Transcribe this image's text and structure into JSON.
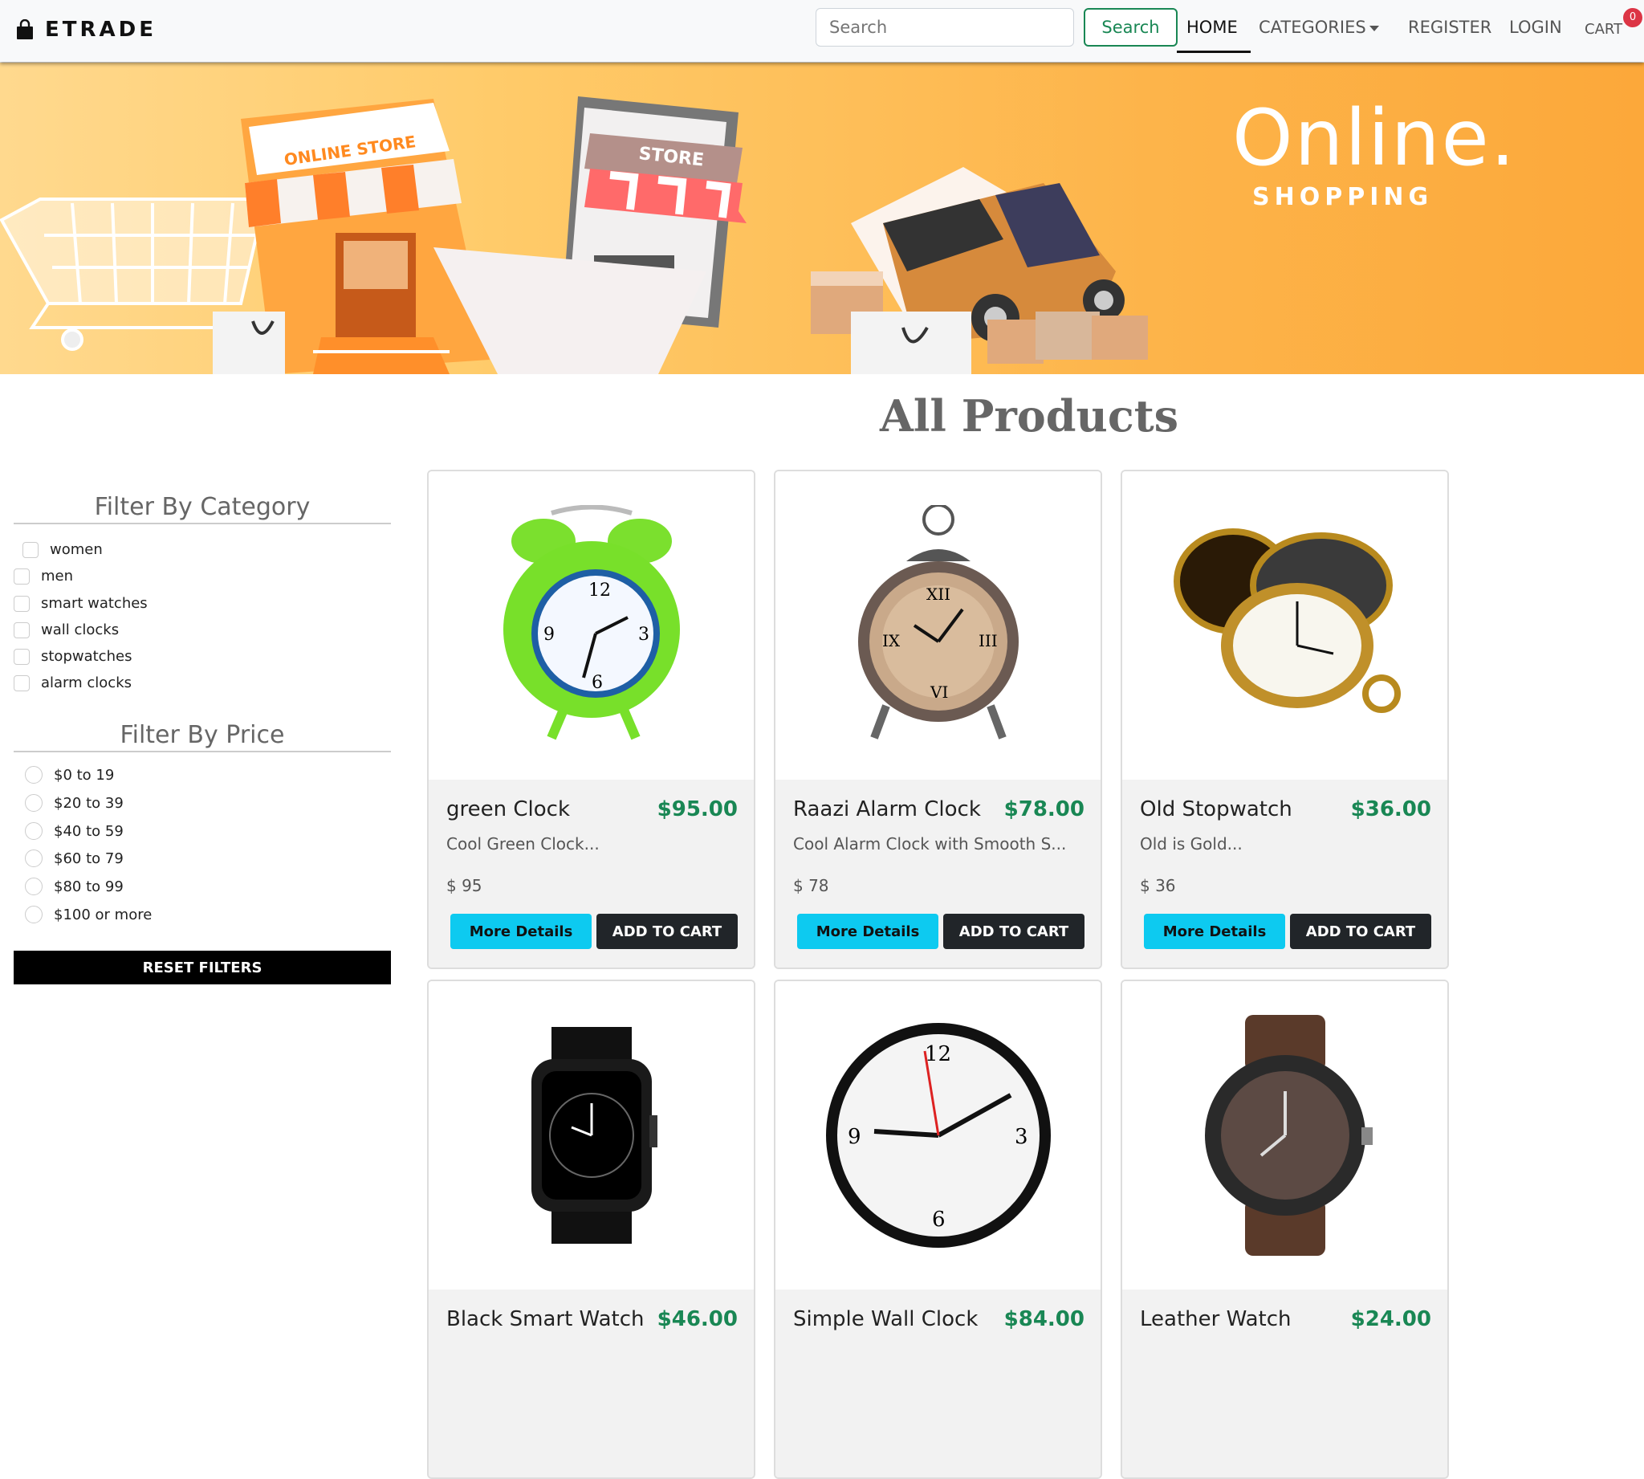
{
  "nav": {
    "brand": "ETRADE",
    "search_placeholder": "Search",
    "search_button": "Search",
    "home": "HOME",
    "categories": "CATEGORIES",
    "register": "REGISTER",
    "login": "LOGIN",
    "cart": "CART",
    "cart_count": "0"
  },
  "banner": {
    "title": "Online.",
    "subtitle": "SHOPPING",
    "store_sign": "ONLINE STORE",
    "phone_sign": "STORE"
  },
  "page_title": "All Products",
  "filters": {
    "category_heading": "Filter By Category",
    "categories": [
      "women",
      "men",
      "smart watches",
      "wall clocks",
      "stopwatches",
      "alarm clocks"
    ],
    "price_heading": "Filter By Price",
    "prices": [
      "$0 to 19",
      "$20 to 39",
      "$40 to 59",
      "$60 to 79",
      "$80 to 99",
      "$100 or more"
    ],
    "reset": "RESET FILTERS"
  },
  "products": [
    {
      "name": "green Clock",
      "price": "$95.00",
      "desc": "Cool Green Clock...",
      "sub": "$ 95",
      "more": "More Details",
      "add": "ADD TO CART"
    },
    {
      "name": "Raazi Alarm Clock",
      "price": "$78.00",
      "desc": "Cool Alarm Clock with Smooth S...",
      "sub": "$ 78",
      "more": "More Details",
      "add": "ADD TO CART"
    },
    {
      "name": "Old Stopwatch",
      "price": "$36.00",
      "desc": "Old is Gold...",
      "sub": "$ 36",
      "more": "More Details",
      "add": "ADD TO CART"
    },
    {
      "name": "Black Smart Watch",
      "price": "$46.00"
    },
    {
      "name": "Simple Wall Clock",
      "price": "$84.00"
    },
    {
      "name": "Leather Watch",
      "price": "$24.00"
    }
  ],
  "colors": {
    "accent_green": "#198754",
    "info_blue": "#0dcaf0",
    "dark": "#212529",
    "badge_red": "#dc3545",
    "banner_orange": "#fdb44a"
  }
}
